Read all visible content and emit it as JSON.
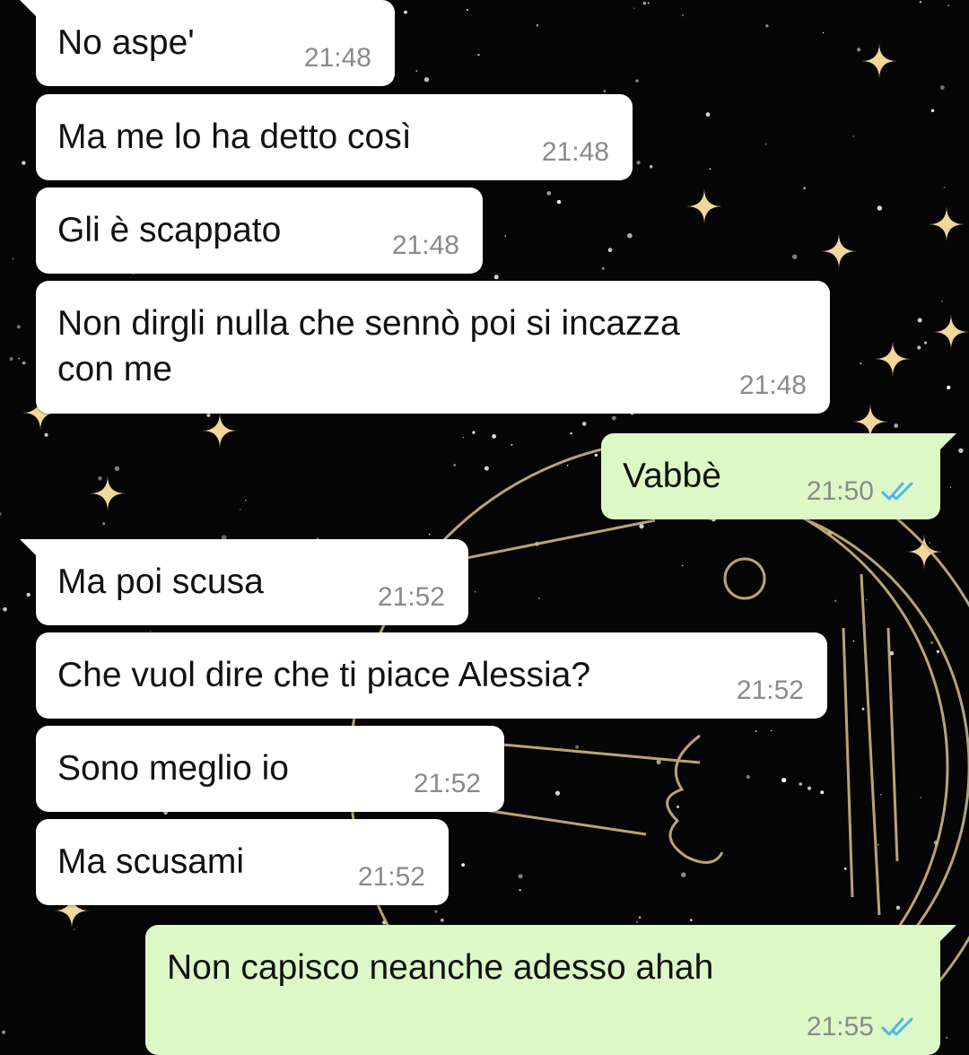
{
  "colors": {
    "incoming_bubble": "#ffffff",
    "outgoing_bubble": "#dcf8c6",
    "timestamp": "#8a8a8a",
    "read_ticks": "#4fb6ec",
    "wallpaper": "#050505",
    "wallpaper_art": "#d8c08a"
  },
  "wallpaper": {
    "description_icon": "celestial-moon-wallpaper"
  },
  "messages": [
    {
      "direction": "in",
      "text": "No aspe'",
      "time": "21:48",
      "tail": true
    },
    {
      "direction": "in",
      "text": "Ma me lo ha detto così",
      "time": "21:48",
      "tail": false
    },
    {
      "direction": "in",
      "text": "Gli è scappato",
      "time": "21:48",
      "tail": false
    },
    {
      "direction": "in",
      "text": "Non dirgli nulla che sennò poi si incazza\ncon me",
      "time": "21:48",
      "tail": false
    },
    {
      "direction": "out",
      "text": "Vabbè",
      "time": "21:50",
      "status": "read",
      "tail": true
    },
    {
      "direction": "in",
      "text": "Ma poi scusa",
      "time": "21:52",
      "tail": true
    },
    {
      "direction": "in",
      "text": "Che vuol dire che ti piace Alessia?",
      "time": "21:52",
      "tail": false
    },
    {
      "direction": "in",
      "text": "Sono meglio io",
      "time": "21:52",
      "tail": false
    },
    {
      "direction": "in",
      "text": "Ma scusami",
      "time": "21:52",
      "tail": false
    },
    {
      "direction": "out",
      "text": "Non capisco neanche adesso ahah",
      "time": "21:55",
      "status": "read",
      "tail": true
    }
  ]
}
